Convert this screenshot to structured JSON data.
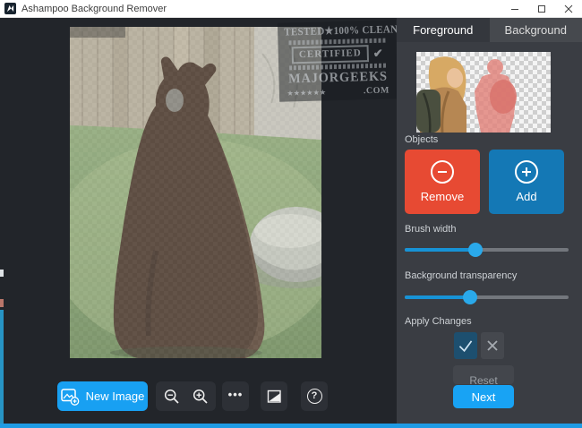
{
  "window": {
    "title": "Ashampoo Background Remover"
  },
  "tabs": {
    "foreground": "Foreground",
    "background": "Background"
  },
  "panel": {
    "objects_label": "Objects",
    "remove_label": "Remove",
    "add_label": "Add",
    "brush_width_label": "Brush width",
    "brush_width_percent": 43,
    "transparency_label": "Background transparency",
    "transparency_percent": 40,
    "apply_label": "Apply Changes",
    "reset_label": "Reset",
    "next_label": "Next"
  },
  "toolbar": {
    "new_image_label": "New Image",
    "more_label": "•••",
    "help_label": "?"
  },
  "watermark": {
    "line1": "TESTED★100% CLEAN",
    "certified": "CERTIFIED",
    "check": "✔",
    "brand": "MAJORGEEKS",
    "stars": "★★★★★★",
    "dotcom": ".COM"
  },
  "colors": {
    "accent_blue": "#18a2f2",
    "remove_red": "#e74a33",
    "add_blue": "#1478b5",
    "slider_fill": "#1793d6",
    "panel_bg": "#3a3d43",
    "canvas_bg": "#22252a",
    "apply_check_bg": "#1d4f6f",
    "bottom_border": "#1e9be4"
  }
}
